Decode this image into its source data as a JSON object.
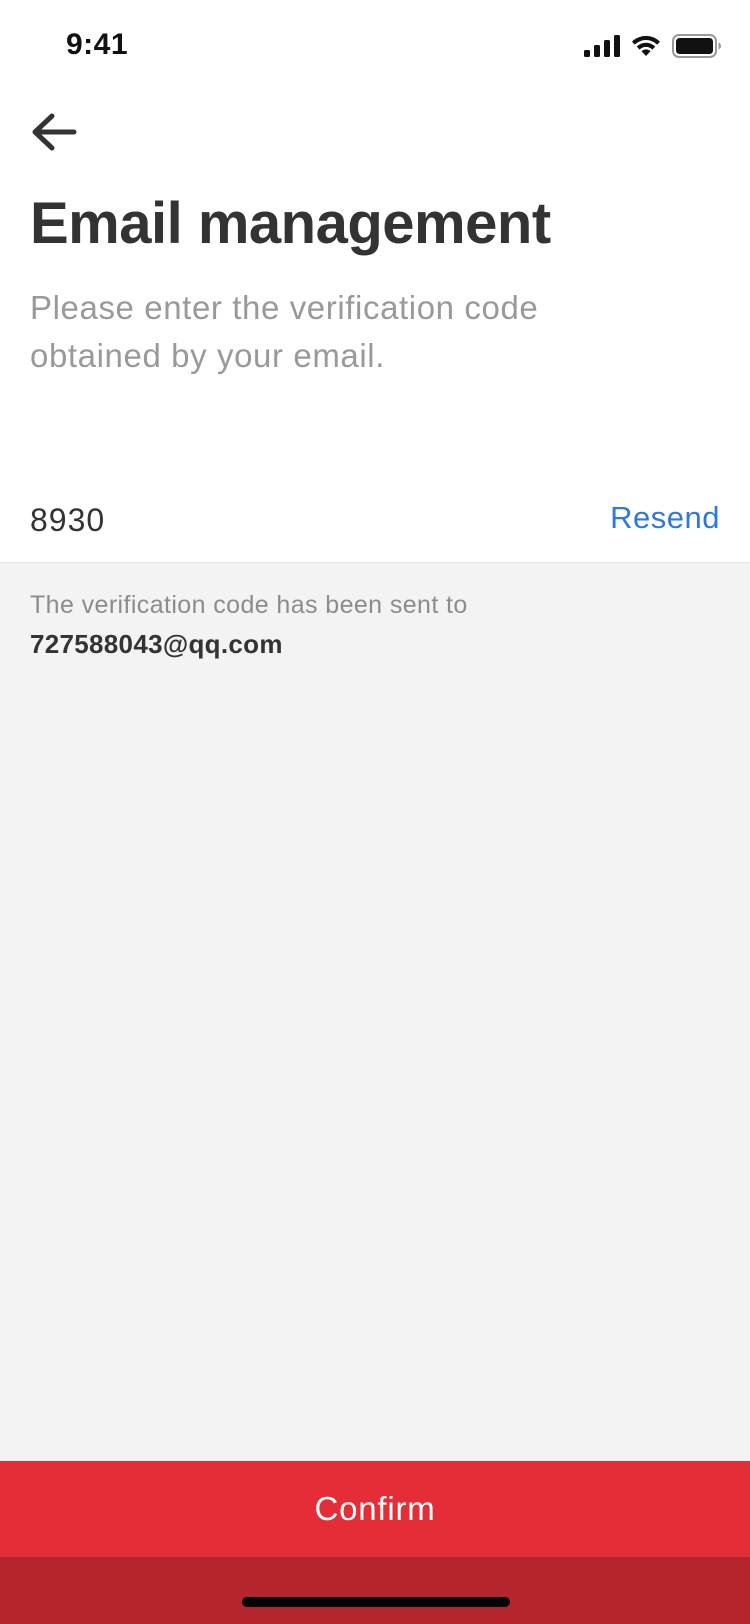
{
  "status_bar": {
    "time": "9:41",
    "icons": [
      "cellular-signal-icon",
      "wifi-icon",
      "battery-icon"
    ]
  },
  "header": {
    "back_icon": "arrow-left-icon",
    "title": "Email management",
    "subtitle": "Please enter the verification code obtained by your email."
  },
  "form": {
    "code_value": "8930",
    "resend_label": "Resend"
  },
  "info": {
    "sent_text": "The verification code has been sent to",
    "email": "727588043@qq.com"
  },
  "footer": {
    "confirm_label": "Confirm"
  },
  "colors": {
    "accent": "#e52d37",
    "link": "#2f7ad7",
    "background_gray": "#f3f3f3",
    "title_text": "#333333",
    "muted_text": "#999999"
  }
}
